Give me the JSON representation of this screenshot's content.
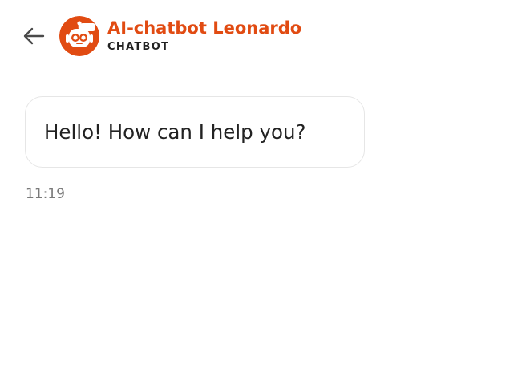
{
  "header": {
    "back_icon": "arrow-left-icon",
    "avatar_icon": "robot-icon",
    "title": "AI-chatbot Leonardo",
    "subtitle": "CHATBOT"
  },
  "messages": [
    {
      "sender": "bot",
      "text": "Hello! How can I help you?",
      "time": "11:19"
    }
  ],
  "colors": {
    "accent": "#e14b12",
    "text": "#222222",
    "muted": "#7a7a7a",
    "border": "#e6e6e6",
    "background": "#ffffff"
  }
}
